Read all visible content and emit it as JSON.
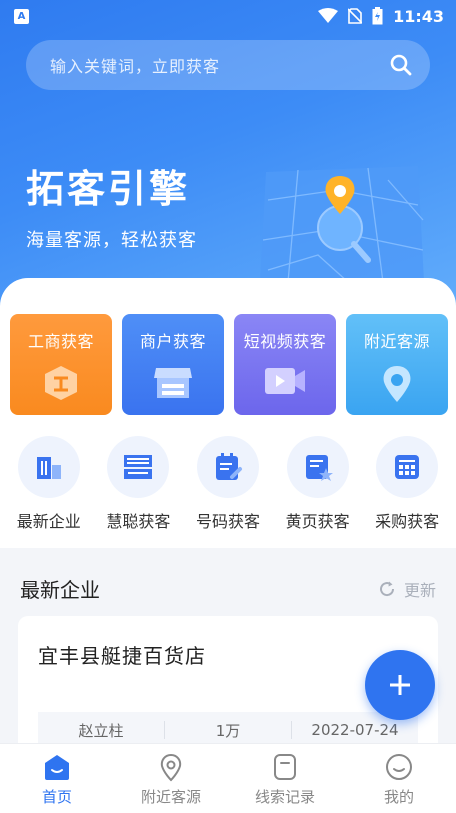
{
  "status_bar": {
    "badge": "A",
    "time": "11:43"
  },
  "search": {
    "placeholder": "输入关键词，立即获客"
  },
  "hero": {
    "title": "拓客引擎",
    "subtitle": "海量客源，轻松获客"
  },
  "features": [
    {
      "label": "工商获客",
      "icon": "business-badge-icon"
    },
    {
      "label": "商户获客",
      "icon": "storefront-icon"
    },
    {
      "label": "短视频获客",
      "icon": "video-camera-icon"
    },
    {
      "label": "附近客源",
      "icon": "location-pin-icon"
    }
  ],
  "quick_links": [
    {
      "label": "最新企业",
      "icon": "building-icon"
    },
    {
      "label": "慧聪获客",
      "icon": "hui-char-icon"
    },
    {
      "label": "号码获客",
      "icon": "notepad-icon"
    },
    {
      "label": "黄页获客",
      "icon": "star-document-icon"
    },
    {
      "label": "采购获客",
      "icon": "grid-box-icon"
    }
  ],
  "section": {
    "title": "最新企业",
    "refresh_label": "更新"
  },
  "company": {
    "name": "宜丰县艇捷百货店",
    "legal_person": "赵立柱",
    "capital": "1万",
    "date": "2022-07-24"
  },
  "bottom_nav": [
    {
      "label": "首页",
      "active": true
    },
    {
      "label": "附近客源",
      "active": false
    },
    {
      "label": "线索记录",
      "active": false
    },
    {
      "label": "我的",
      "active": false
    }
  ],
  "colors": {
    "primary": "#2f74f0",
    "orange": "#f98a1f",
    "purple": "#6c66ec",
    "sky": "#3aa4f1"
  }
}
